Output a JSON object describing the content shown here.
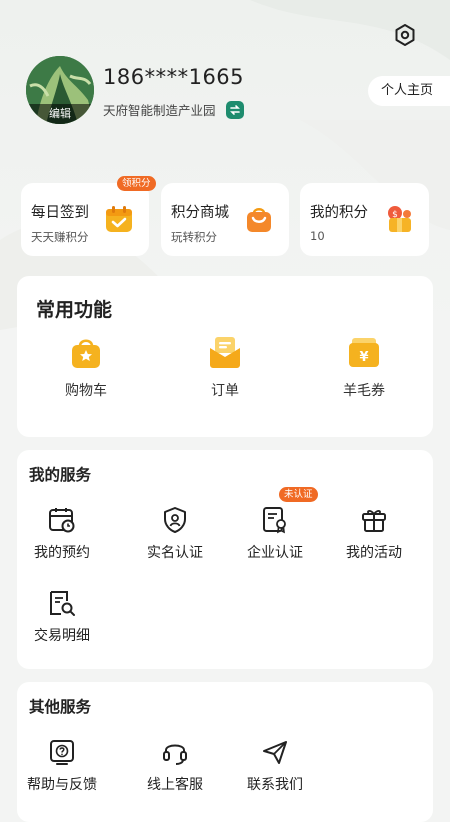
{
  "header": {
    "phone": "186****1665",
    "park": "天府智能制造产业园",
    "avatar_edit": "编辑",
    "profile_button": "个人主页"
  },
  "points_badge": "领积分",
  "points_cards": [
    {
      "title": "每日签到",
      "subtitle": "天天赚积分",
      "icon": "calendar-check-icon"
    },
    {
      "title": "积分商城",
      "subtitle": "玩转积分",
      "icon": "shopping-bag-icon"
    },
    {
      "title": "我的积分",
      "subtitle": "10",
      "icon": "coin-gift-icon"
    }
  ],
  "common": {
    "title": "常用功能",
    "items": [
      {
        "label": "购物车",
        "icon": "cart-bag-icon"
      },
      {
        "label": "订单",
        "icon": "order-icon"
      },
      {
        "label": "羊毛券",
        "icon": "coupon-icon"
      }
    ]
  },
  "services": {
    "title": "我的服务",
    "unauth_badge": "未认证",
    "items": [
      {
        "label": "我的预约",
        "icon": "calendar-clock-icon"
      },
      {
        "label": "实名认证",
        "icon": "shield-user-icon"
      },
      {
        "label": "企业认证",
        "icon": "company-cert-icon"
      },
      {
        "label": "我的活动",
        "icon": "gift-box-icon"
      },
      {
        "label": "交易明细",
        "icon": "receipt-search-icon"
      }
    ]
  },
  "other": {
    "title": "其他服务",
    "items": [
      {
        "label": "帮助与反馈",
        "icon": "help-feedback-icon"
      },
      {
        "label": "线上客服",
        "icon": "headset-icon"
      },
      {
        "label": "联系我们",
        "icon": "paper-plane-icon"
      }
    ]
  },
  "colors": {
    "accent_orange": "#f06a24",
    "icon_gold": "#f5b21f",
    "background": "#f3f4f3"
  }
}
